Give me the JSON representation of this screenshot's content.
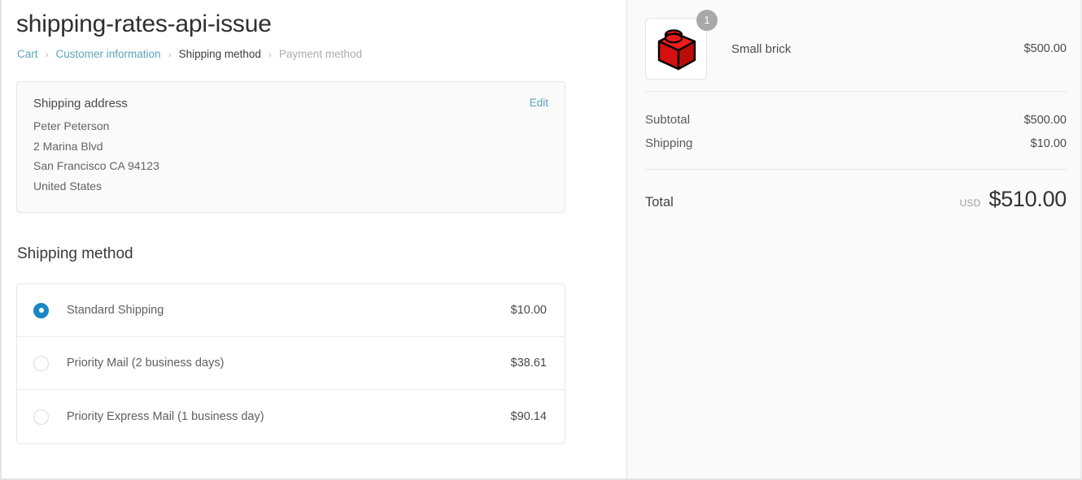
{
  "header": {
    "title": "shipping-rates-api-issue"
  },
  "breadcrumb": {
    "items": [
      {
        "label": "Cart",
        "state": "link"
      },
      {
        "label": "Customer information",
        "state": "link"
      },
      {
        "label": "Shipping method",
        "state": "current"
      },
      {
        "label": "Payment method",
        "state": "future"
      }
    ],
    "separator": "›"
  },
  "shipping_address": {
    "title": "Shipping address",
    "edit_label": "Edit",
    "lines": [
      "Peter Peterson",
      "2 Marina Blvd",
      "San Francisco CA 94123",
      "United States"
    ]
  },
  "shipping_method": {
    "section_title": "Shipping method",
    "options": [
      {
        "label": "Standard Shipping",
        "price": "$10.00",
        "selected": true
      },
      {
        "label": "Priority Mail (2 business days)",
        "price": "$38.61",
        "selected": false
      },
      {
        "label": "Priority Express Mail (1 business day)",
        "price": "$90.14",
        "selected": false
      }
    ]
  },
  "order_summary": {
    "item": {
      "name": "Small brick",
      "price": "$500.00",
      "quantity": "1",
      "thumbnail_icon": "red-lego-brick-icon"
    },
    "lines": [
      {
        "label": "Subtotal",
        "amount": "$500.00"
      },
      {
        "label": "Shipping",
        "amount": "$10.00"
      }
    ],
    "total": {
      "label": "Total",
      "currency": "USD",
      "amount": "$510.00"
    }
  },
  "colors": {
    "link": "#5ba3bd",
    "radio_selected": "#1b86c4",
    "panel_background": "#fafafa",
    "brick_red": "#e51b1b",
    "badge_grey": "#a8a8a8"
  }
}
